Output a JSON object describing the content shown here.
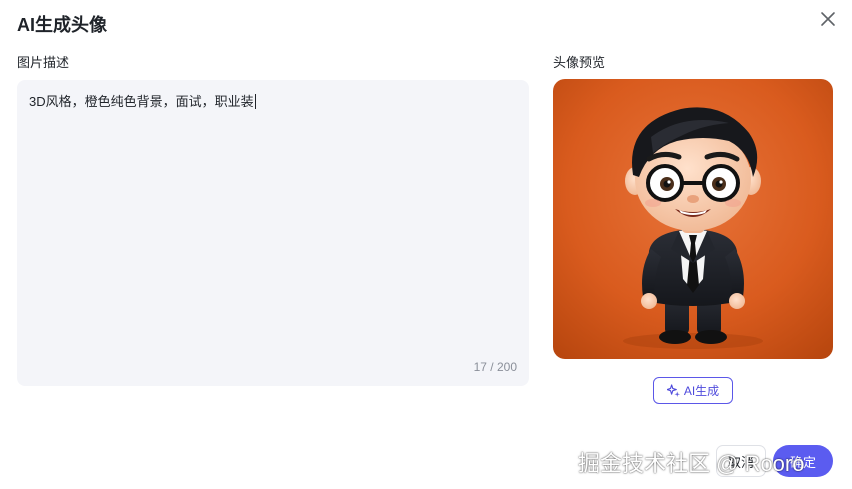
{
  "dialog": {
    "title": "AI生成头像"
  },
  "icons": {
    "close": "close-icon",
    "sparkle": "sparkle-icon"
  },
  "description": {
    "label": "图片描述",
    "value": "3D风格，橙色纯色背景，面试，职业装",
    "counter": "17 / 200"
  },
  "preview": {
    "label": "头像预览"
  },
  "ai_button": {
    "label": "AI生成"
  },
  "footer": {
    "cancel_label": "取消",
    "ok_label": "确定"
  },
  "watermark": {
    "text": "掘金技术社区 @ Rooro"
  },
  "colors": {
    "accent": "#5b5cf0",
    "input_bg": "#f4f5f9",
    "preview_bg": "#e0601f"
  }
}
